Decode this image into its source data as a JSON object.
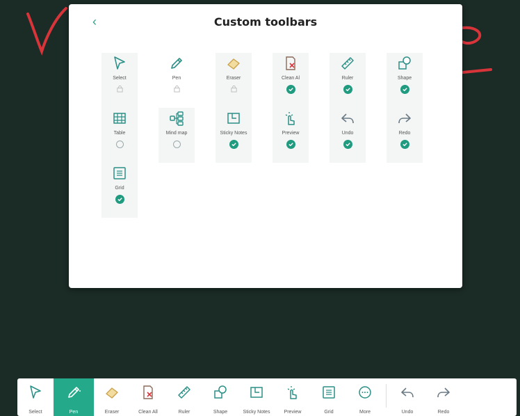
{
  "colors": {
    "accent": "#24a98b",
    "check": "#1f9b7f",
    "background": "#1b2b26",
    "ink": "#d8353b"
  },
  "panel": {
    "back_icon": "chevron-left-icon",
    "title": "Custom toolbars",
    "items": [
      {
        "label": "Select",
        "icon": "cursor-icon",
        "state": "locked"
      },
      {
        "label": "Pen",
        "icon": "pen-icon",
        "state": "locked"
      },
      {
        "label": "Eraser",
        "icon": "eraser-icon",
        "state": "locked"
      },
      {
        "label": "Clean Al",
        "icon": "clean-all-icon",
        "state": "checked"
      },
      {
        "label": "Ruler",
        "icon": "ruler-icon",
        "state": "checked"
      },
      {
        "label": "Shape",
        "icon": "shape-icon",
        "state": "checked"
      },
      {
        "label": "Table",
        "icon": "table-icon",
        "state": "unchecked"
      },
      {
        "label": "Mind map",
        "icon": "mind-map-icon",
        "state": "unchecked"
      },
      {
        "label": "Sticky Notes",
        "icon": "sticky-notes-icon",
        "state": "checked"
      },
      {
        "label": "Preview",
        "icon": "preview-icon",
        "state": "checked"
      },
      {
        "label": "Undo",
        "icon": "undo-icon",
        "state": "checked"
      },
      {
        "label": "Redo",
        "icon": "redo-icon",
        "state": "checked"
      },
      {
        "label": "Grid",
        "icon": "grid-icon",
        "state": "checked"
      }
    ]
  },
  "toolbar": {
    "items": [
      {
        "label": "Select",
        "icon": "cursor-icon"
      },
      {
        "label": "Pen",
        "icon": "pen-icon",
        "selected": true
      },
      {
        "label": "Eraser",
        "icon": "eraser-icon"
      },
      {
        "label": "Clean All",
        "icon": "clean-all-icon"
      },
      {
        "label": "Ruler",
        "icon": "ruler-icon"
      },
      {
        "label": "Shape",
        "icon": "shape-icon"
      },
      {
        "label": "Sticky Notes",
        "icon": "sticky-notes-icon"
      },
      {
        "label": "Preview",
        "icon": "preview-icon"
      },
      {
        "label": "Grid",
        "icon": "grid-icon"
      },
      {
        "label": "More",
        "icon": "more-icon"
      },
      {
        "label": "Undo",
        "icon": "undo-icon"
      },
      {
        "label": "Redo",
        "icon": "redo-icon"
      }
    ]
  }
}
